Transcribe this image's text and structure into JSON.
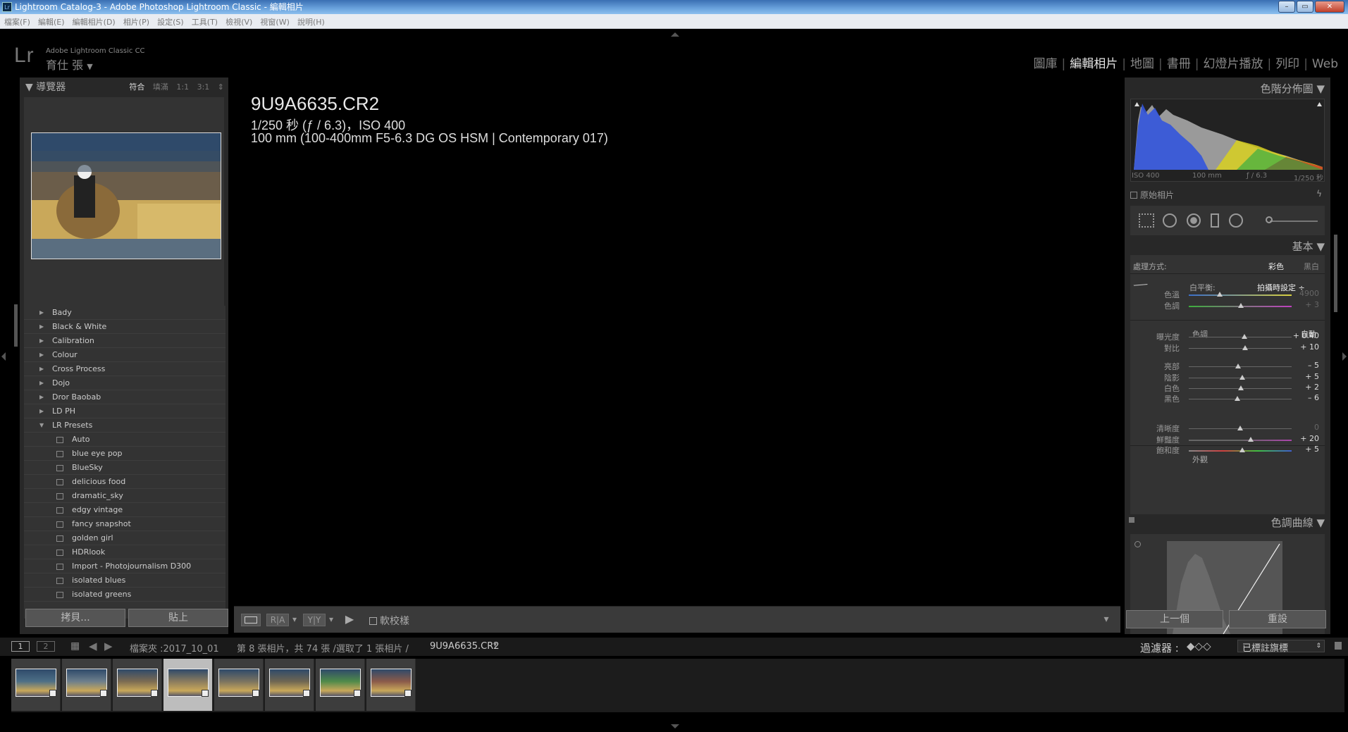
{
  "window": {
    "title": "Lightroom Catalog-3 - Adobe Photoshop Lightroom Classic - 編輯相片",
    "icon_label": "Lr"
  },
  "menu": [
    "檔案(F)",
    "編輯(E)",
    "編輯相片(D)",
    "相片(P)",
    "設定(S)",
    "工具(T)",
    "檢視(V)",
    "視窗(W)",
    "說明(H)"
  ],
  "identity": {
    "logo": "Lr",
    "product": "Adobe Lightroom Classic CC",
    "user": "育仕 張",
    "user_caret": "▼"
  },
  "modules": [
    {
      "label": "圖庫",
      "active": false
    },
    {
      "label": "編輯相片",
      "active": true
    },
    {
      "label": "地圖",
      "active": false
    },
    {
      "label": "書冊",
      "active": false
    },
    {
      "label": "幻燈片播放",
      "active": false
    },
    {
      "label": "列印",
      "active": false
    },
    {
      "label": "Web",
      "active": false
    }
  ],
  "navigator": {
    "title": "導覽器",
    "zooms": [
      "符合",
      "填滿",
      "1:1",
      "3:1"
    ],
    "selected_zoom": "符合"
  },
  "presets": [
    {
      "label": "Bady",
      "type": "folder"
    },
    {
      "label": "Black & White",
      "type": "folder"
    },
    {
      "label": "Calibration",
      "type": "folder"
    },
    {
      "label": "Colour",
      "type": "folder"
    },
    {
      "label": "Cross Process",
      "type": "folder"
    },
    {
      "label": "Dojo",
      "type": "folder"
    },
    {
      "label": "Dror Baobab",
      "type": "folder"
    },
    {
      "label": "LD PH",
      "type": "folder"
    },
    {
      "label": "LR Presets",
      "type": "open-folder"
    },
    {
      "label": "Auto",
      "type": "preset"
    },
    {
      "label": "blue eye pop",
      "type": "preset"
    },
    {
      "label": "BlueSky",
      "type": "preset"
    },
    {
      "label": "delicious food",
      "type": "preset"
    },
    {
      "label": "dramatic_sky",
      "type": "preset"
    },
    {
      "label": "edgy vintage",
      "type": "preset"
    },
    {
      "label": "fancy snapshot",
      "type": "preset"
    },
    {
      "label": "golden girl",
      "type": "preset"
    },
    {
      "label": "HDRlook",
      "type": "preset"
    },
    {
      "label": "Import - Photojournalism D300",
      "type": "preset"
    },
    {
      "label": "isolated blues",
      "type": "preset"
    },
    {
      "label": "isolated greens",
      "type": "preset"
    }
  ],
  "left_buttons": {
    "copy": "拷貝...",
    "paste": "貼上"
  },
  "image_info": {
    "filename": "9U9A6635.CR2",
    "exposure": "1/250 秒 (ƒ / 6.3)，ISO 400",
    "lens": "100 mm (100-400mm F5-6.3 DG OS HSM | Contemporary 017)"
  },
  "toolbar": {
    "soft_proof": "軟校樣",
    "btn_ra": "R|A",
    "btn_yy": "Y|Y"
  },
  "histogram": {
    "title": "色階分佈圖",
    "meta": [
      "ISO 400",
      "100 mm",
      "ƒ / 6.3",
      "1/250 秒"
    ],
    "original_photo": "原始相片"
  },
  "basic": {
    "title": "基本",
    "treatment_label": "處理方式:",
    "treatment_color": "彩色",
    "treatment_bw": "黑白",
    "wb_label": "白平衡:",
    "wb_value": "拍攝時設定 ÷",
    "tone_label": "色調",
    "tone_auto": "自動",
    "presence_label": "外觀",
    "sliders": [
      {
        "key": "色溫",
        "value": "4900",
        "pos": 0.3,
        "dim": true,
        "color": "temp"
      },
      {
        "key": "色調",
        "value": "+ 3",
        "pos": 0.51,
        "dim": true,
        "color": "tint"
      },
      {
        "key": "曝光度",
        "value": "+ 0.40",
        "pos": 0.54,
        "dim": false,
        "color": ""
      },
      {
        "key": "對比",
        "value": "+ 10",
        "pos": 0.55,
        "dim": false,
        "color": ""
      },
      {
        "key": "亮部",
        "value": "– 5",
        "pos": 0.48,
        "dim": false,
        "color": ""
      },
      {
        "key": "陰影",
        "value": "+ 5",
        "pos": 0.52,
        "dim": false,
        "color": ""
      },
      {
        "key": "白色",
        "value": "+ 2",
        "pos": 0.51,
        "dim": false,
        "color": ""
      },
      {
        "key": "黑色",
        "value": "– 6",
        "pos": 0.47,
        "dim": false,
        "color": ""
      },
      {
        "key": "清晰度",
        "value": "0",
        "pos": 0.5,
        "dim": true,
        "color": ""
      },
      {
        "key": "鮮豔度",
        "value": "+ 20",
        "pos": 0.6,
        "dim": false,
        "color": "vib"
      },
      {
        "key": "飽和度",
        "value": "+ 5",
        "pos": 0.52,
        "dim": false,
        "color": "sat"
      }
    ]
  },
  "tone_curve": {
    "title": "色調曲線"
  },
  "right_buttons": {
    "previous": "上一個",
    "reset": "重設"
  },
  "filmstrip_bar": {
    "page1": "1",
    "page2": "2",
    "folder": "檔案夾 :2017_10_01",
    "selection": "第 8 張相片，共 74 張 /選取了 1 張相片 /",
    "current_file": "9U9A6635.CR2",
    "filter_label": "過濾器 :",
    "filter_value": "已標註旗標"
  },
  "thumbnails": [
    {
      "selected": false
    },
    {
      "selected": false
    },
    {
      "selected": false
    },
    {
      "selected": true
    },
    {
      "selected": false
    },
    {
      "selected": false
    },
    {
      "selected": false
    },
    {
      "selected": false
    }
  ],
  "colors": {
    "accent": "#e2e2e2",
    "panel": "#282828",
    "panel_inner": "#333333",
    "background": "#000000"
  }
}
